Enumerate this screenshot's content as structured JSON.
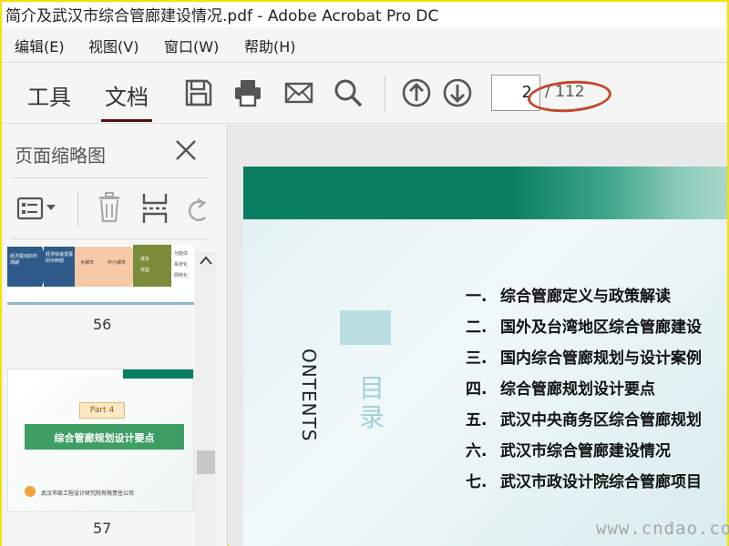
{
  "window": {
    "title": "简介及武汉市综合管廊建设情况.pdf - Adobe Acrobat Pro DC"
  },
  "menu": [
    "编辑(E)",
    "视图(V)",
    "窗口(W)",
    "帮助(H)"
  ],
  "toolbar": {
    "tab_tools": "工具",
    "tab_document": "文档",
    "icons": [
      "save-icon",
      "print-icon",
      "mail-icon",
      "search-icon",
      "arrow-up-icon",
      "arrow-down-icon"
    ],
    "page_current": "2",
    "page_total": "/ 112"
  },
  "sidepanel": {
    "title": "页面缩略图",
    "thumbs": [
      {
        "page_label": "56",
        "boxes": [
          "经济驱动的市场期",
          "经济快速发展的中西部",
          "大城市",
          "中小城市",
          "成本",
          "效益"
        ],
        "right_labels": [
          "功能体",
          "系统化",
          "网络化"
        ]
      },
      {
        "page_label": "57",
        "part": "Part 4",
        "heading": "综合管廊规划设计要点",
        "footer": "武汉市政工程设计研究院有限责任公司"
      }
    ]
  },
  "document": {
    "contents_word": "ONTENTS",
    "mulu": "目录",
    "toc": [
      {
        "num": "一.",
        "text": "综合管廊定义与政策解读"
      },
      {
        "num": "二.",
        "text": "国外及台湾地区综合管廊建设"
      },
      {
        "num": "三.",
        "text": "国内综合管廊规划与设计案例"
      },
      {
        "num": "四.",
        "text": "综合管廊规划设计要点"
      },
      {
        "num": "五.",
        "text": "武汉中央商务区综合管廊规划"
      },
      {
        "num": "六.",
        "text": "武汉市综合管廊建设情况"
      },
      {
        "num": "七.",
        "text": "武汉市政设计院综合管廊项目"
      }
    ]
  },
  "watermark": "www.cndao.com",
  "colors": {
    "accent_tab": "#5a0e0e",
    "header_green": "#0a7e63",
    "highlight_ellipse": "#c2472d"
  }
}
